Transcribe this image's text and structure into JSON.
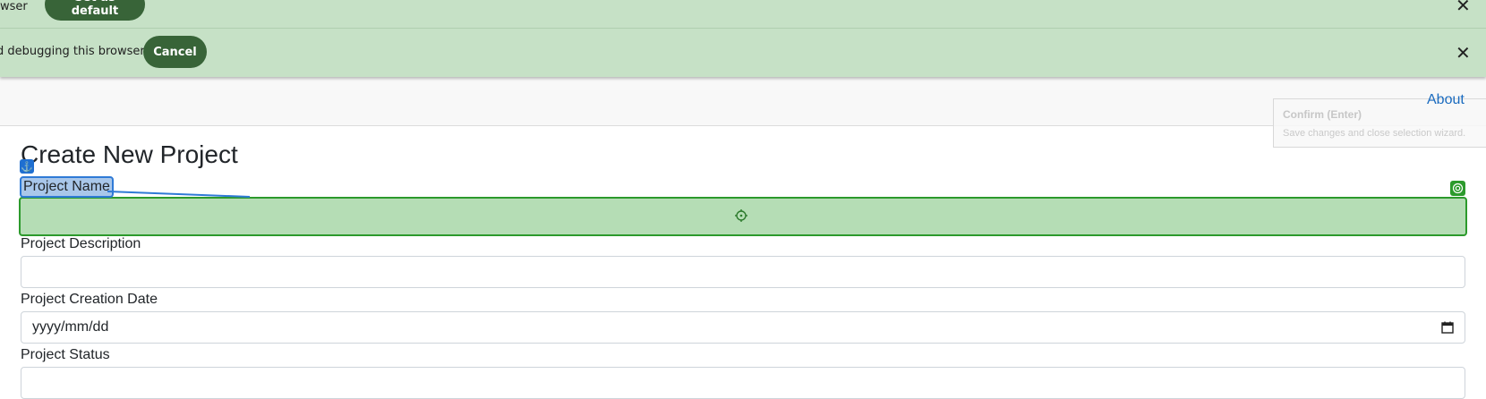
{
  "infobars": {
    "default_browser": {
      "message": "owser",
      "button_label": "Set as default",
      "close_label": "✕"
    },
    "debugging": {
      "message": "d debugging this browser",
      "button_label": "Cancel",
      "close_label": "✕"
    }
  },
  "navbar": {
    "about_label": "About"
  },
  "tooltip": {
    "title": "Confirm (Enter)",
    "subtitle": "Save changes and close selection wizard."
  },
  "form": {
    "title": "Create New Project",
    "fields": {
      "name_label": "Project Name",
      "description_label": "Project Description",
      "date_label": "Project Creation Date",
      "date_placeholder": "yyyy/mm/dd",
      "status_label": "Project Status"
    }
  },
  "icons": {
    "anchor": "anchor-icon",
    "target": "crosshair-icon",
    "calendar": "calendar-icon",
    "close": "close-icon"
  },
  "colors": {
    "infobar_bg": "#c6e1c6",
    "infobar_button": "#386438",
    "selection_green": "#2c9a2c",
    "selection_blue": "#2f7ad6",
    "link_blue": "#1a6bbf"
  }
}
